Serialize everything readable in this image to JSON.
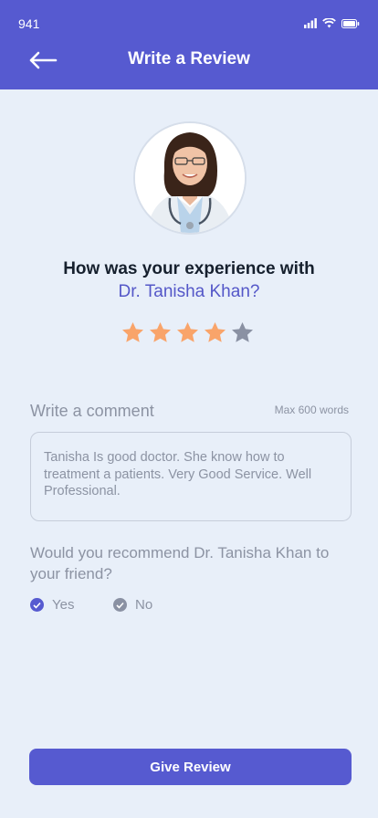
{
  "status_bar": {
    "time": "941"
  },
  "header": {
    "title": "Write a Review"
  },
  "question": {
    "line1": "How was your experience with",
    "doctor_name": "Dr. Tanisha Khan?"
  },
  "rating": {
    "value": 4,
    "max": 5,
    "filled_color": "#F9A46A",
    "empty_color": "#8A91A3"
  },
  "comment": {
    "label": "Write a comment",
    "limit": "Max 600 words",
    "text": "Tanisha Is good doctor. She know how to treatment a patients. Very Good Service. Well Professional."
  },
  "recommend": {
    "question": "Would you recommend Dr. Tanisha Khan to your friend?",
    "options": [
      {
        "label": "Yes",
        "selected": true
      },
      {
        "label": "No",
        "selected": false
      }
    ]
  },
  "submit": {
    "label": "Give Review"
  },
  "colors": {
    "primary": "#565AD0",
    "background": "#E8EFF9",
    "muted": "#8C93A3"
  }
}
